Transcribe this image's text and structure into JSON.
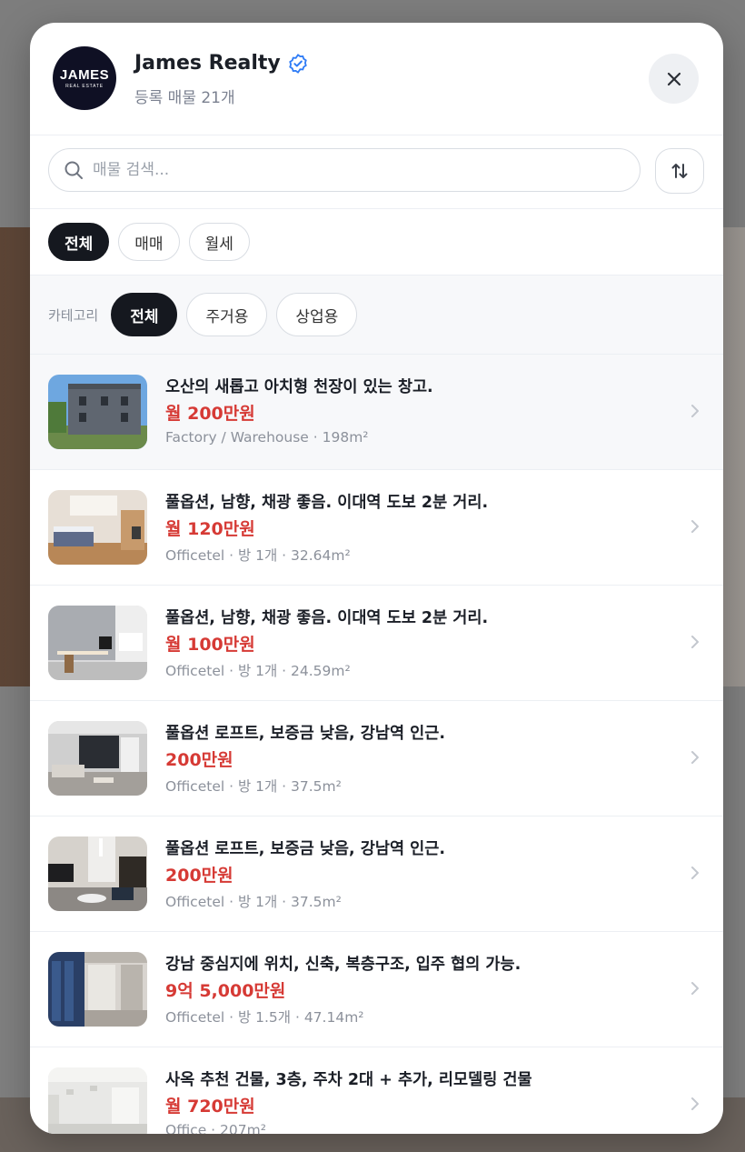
{
  "agency": {
    "logo_main": "JAMES",
    "logo_sub": "REAL ESTATE",
    "name": "James Realty",
    "listing_count": "등록 매물 21개"
  },
  "search": {
    "placeholder": "매물 검색..."
  },
  "deal_filters": [
    {
      "label": "전체",
      "active": true
    },
    {
      "label": "매매",
      "active": false
    },
    {
      "label": "월세",
      "active": false
    }
  ],
  "category": {
    "label": "카테고리",
    "options": [
      {
        "label": "전체",
        "active": true
      },
      {
        "label": "주거용",
        "active": false
      },
      {
        "label": "상업용",
        "active": false
      }
    ]
  },
  "listings": [
    {
      "title": "오산의 새롭고 아치형 천장이 있는 창고.",
      "price": "월 200만원",
      "meta": "Factory / Warehouse · 198m²",
      "thumb": "warehouse"
    },
    {
      "title": "풀옵션, 남향, 채광 좋음. 이대역 도보 2분 거리.",
      "price": "월 120만원",
      "meta": "Officetel · 방 1개 · 32.64m²",
      "thumb": "bedroom"
    },
    {
      "title": "풀옵션, 남향, 채광 좋음. 이대역 도보 2분 거리.",
      "price": "월 100만원",
      "meta": "Officetel · 방 1개 · 24.59m²",
      "thumb": "office-room"
    },
    {
      "title": "풀옵션 로프트, 보증금 낮음, 강남역 인근.",
      "price": "200만원",
      "meta": "Officetel · 방 1개 · 37.5m²",
      "thumb": "loft-living"
    },
    {
      "title": "풀옵션 로프트, 보증금 낮음, 강남역 인근.",
      "price": "200만원",
      "meta": "Officetel · 방 1개 · 37.5m²",
      "thumb": "loft-tv"
    },
    {
      "title": "강남 중심지에 위치, 신축, 복층구조, 입주 협의 가능.",
      "price": "9억 5,000만원",
      "meta": "Officetel · 방 1.5개 · 47.14m²",
      "thumb": "duplex"
    },
    {
      "title": "사옥 추천 건물, 3층, 주차 2대 + 추가, 리모델링 건물",
      "price": "월 720만원",
      "meta": "Office · 207m²",
      "thumb": "office"
    }
  ],
  "colors": {
    "price": "#d63a35",
    "active_chip": "#15181f",
    "verified": "#2f7cf6"
  }
}
